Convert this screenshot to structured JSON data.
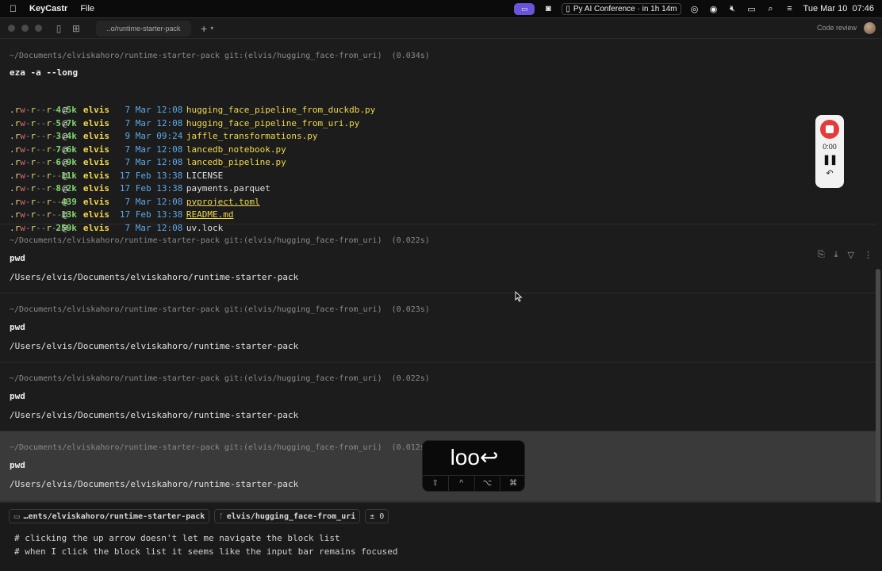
{
  "menubar": {
    "app_name": "KeyCastr",
    "file_menu": "File",
    "conference": "Py AI Conference · in 1h 14m",
    "clock": "Tue Mar 10  07:46"
  },
  "titlebar": {
    "tab_label": "..o/runtime-starter-pack",
    "code_review": "Code review"
  },
  "blocks": [
    {
      "prompt": "~/Documents/elviskahoro/runtime-starter-pack git:(elvis/hugging_face-from_uri)  (0.034s)",
      "command": "eza -a --long",
      "ls": [
        {
          "perm": ".rw-r--r--@",
          "size": "4.5k",
          "user": "elvis",
          "date": " 7 Mar 12:08",
          "name": "hugging_face_pipeline_from_duckdb.py",
          "kind": "py"
        },
        {
          "perm": ".rw-r--r--@",
          "size": "5.7k",
          "user": "elvis",
          "date": " 7 Mar 12:08",
          "name": "hugging_face_pipeline_from_uri.py",
          "kind": "py"
        },
        {
          "perm": ".rw-r--r--@",
          "size": "3.4k",
          "user": "elvis",
          "date": " 9 Mar 09:24",
          "name": "jaffle_transformations.py",
          "kind": "py"
        },
        {
          "perm": ".rw-r--r--@",
          "size": "7.6k",
          "user": "elvis",
          "date": " 7 Mar 12:08",
          "name": "lancedb_notebook.py",
          "kind": "py"
        },
        {
          "perm": ".rw-r--r--@",
          "size": "6.9k",
          "user": "elvis",
          "date": " 7 Mar 12:08",
          "name": "lancedb_pipeline.py",
          "kind": "py"
        },
        {
          "perm": ".rw-r--r--@",
          "size": "11k",
          "user": "elvis",
          "date": "17 Feb 13:38",
          "name": "LICENSE",
          "kind": "plain"
        },
        {
          "perm": ".rw-r--r--@",
          "size": "8.2k",
          "user": "elvis",
          "date": "17 Feb 13:38",
          "name": "payments.parquet",
          "kind": "plain"
        },
        {
          "perm": ".rw-r--r--@",
          "size": "439",
          "user": "elvis",
          "date": " 7 Mar 12:08",
          "name": "pyproject.toml",
          "kind": "ul"
        },
        {
          "perm": ".rw-r--r--@",
          "size": "13k",
          "user": "elvis",
          "date": "17 Feb 13:38",
          "name": "README.md",
          "kind": "ul"
        },
        {
          "perm": ".rw-r--r--@",
          "size": "259k",
          "user": "elvis",
          "date": " 7 Mar 12:08",
          "name": "uv.lock",
          "kind": "plain"
        }
      ]
    },
    {
      "prompt": "~/Documents/elviskahoro/runtime-starter-pack git:(elvis/hugging_face-from_uri)  (0.022s)",
      "command": "pwd",
      "output": "/Users/elvis/Documents/elviskahoro/runtime-starter-pack"
    },
    {
      "prompt": "~/Documents/elviskahoro/runtime-starter-pack git:(elvis/hugging_face-from_uri)  (0.023s)",
      "command": "pwd",
      "output": "/Users/elvis/Documents/elviskahoro/runtime-starter-pack"
    },
    {
      "prompt": "~/Documents/elviskahoro/runtime-starter-pack git:(elvis/hugging_face-from_uri)  (0.022s)",
      "command": "pwd",
      "output": "/Users/elvis/Documents/elviskahoro/runtime-starter-pack"
    },
    {
      "prompt": "~/Documents/elviskahoro/runtime-starter-pack git:(elvis/hugging_face-from_uri)  (0.012s)",
      "command": "pwd",
      "output": "/Users/elvis/Documents/elviskahoro/runtime-starter-pack"
    }
  ],
  "recorder": {
    "time": "0:00"
  },
  "keycastr": {
    "text": "loo↩",
    "mods": [
      "⇧",
      "^",
      "⌥",
      "⌘"
    ]
  },
  "inputbar": {
    "dir_chip": "…ents/elviskahoro/runtime-starter-pack",
    "branch_chip": "elvis/hugging_face-from_uri",
    "diff_chip": "± 0",
    "lines": [
      "# clicking the up arrow doesn't let me navigate the block list",
      "# when I click the block list it seems like the input bar remains focused"
    ]
  },
  "colors": {
    "accent_purple": "#6a55d9",
    "record_red": "#e53b3b",
    "size_green": "#7ed46a",
    "user_yellow": "#f0d94a",
    "date_blue": "#5fa8e8"
  }
}
